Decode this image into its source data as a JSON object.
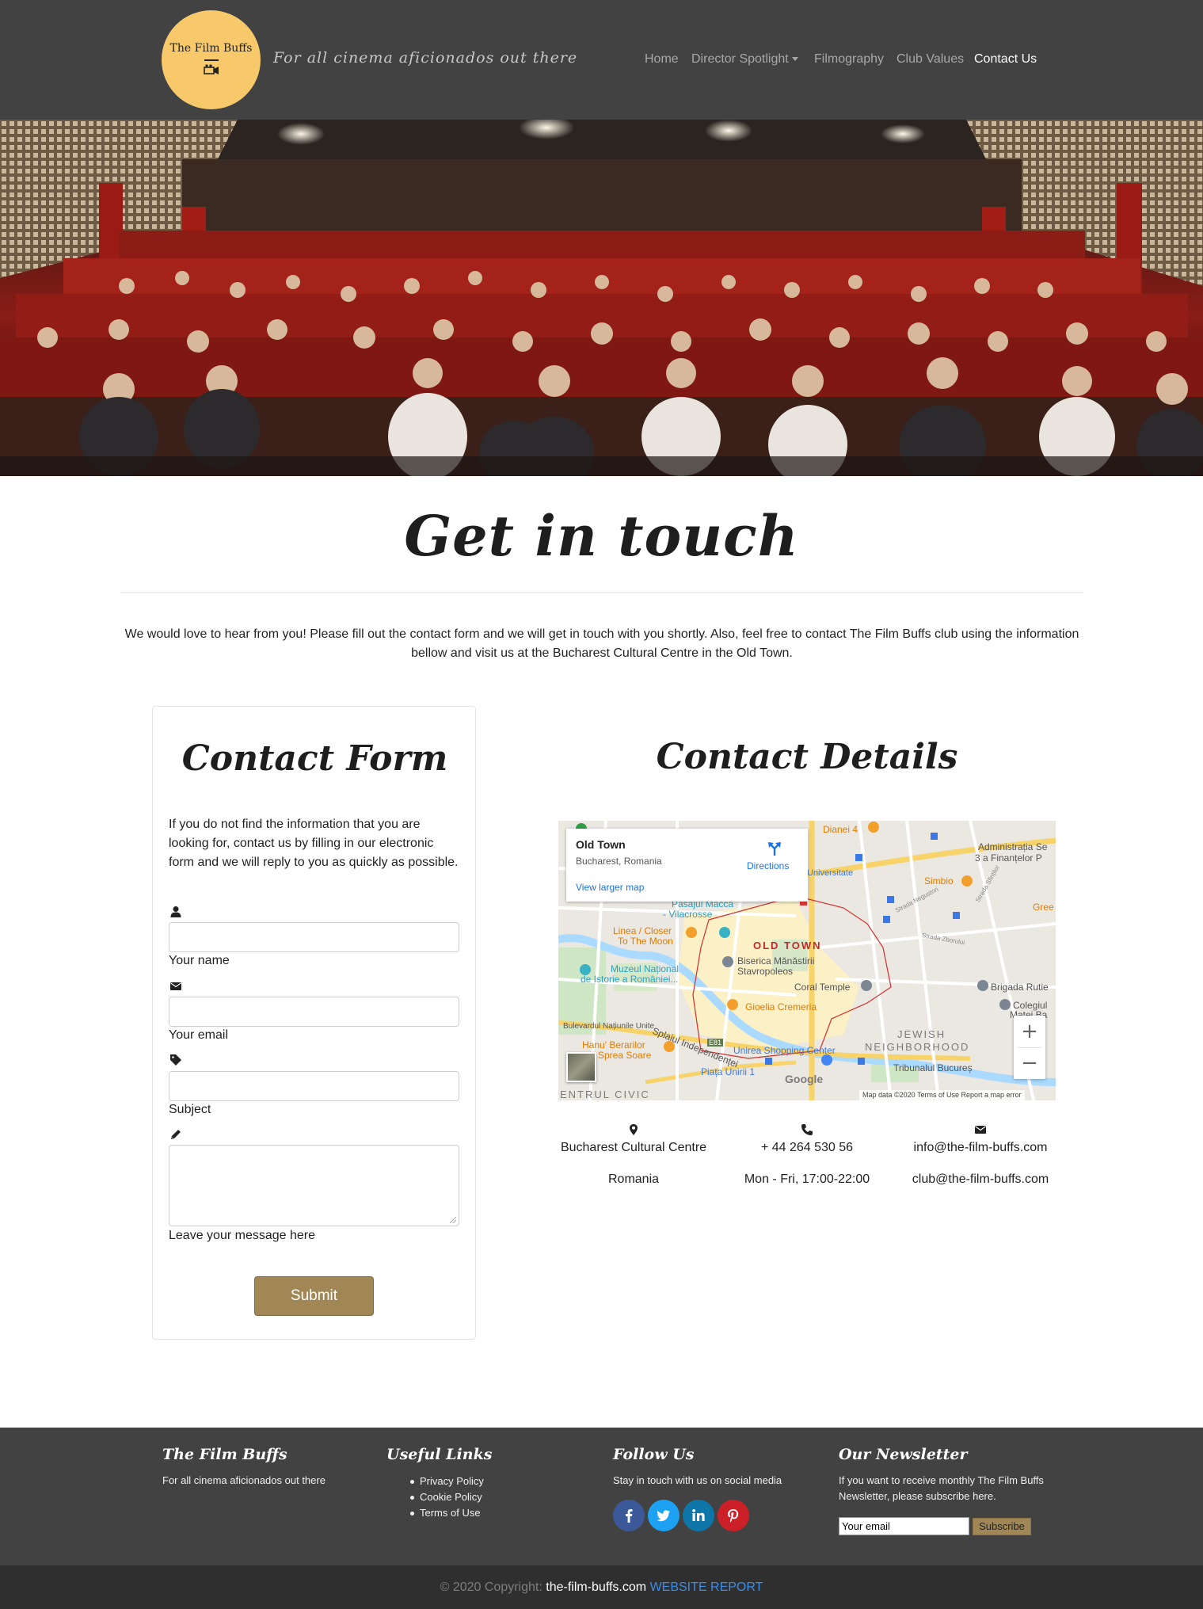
{
  "navbar": {
    "logo_text": "The Film Buffs",
    "tagline": "For all cinema aficionados out there",
    "links": [
      {
        "label": "Home"
      },
      {
        "label": "Director Spotlight"
      },
      {
        "label": "Filmography"
      },
      {
        "label": "Club Values"
      },
      {
        "label": "Contact Us"
      }
    ],
    "active": "Contact Us"
  },
  "hero": {
    "icon": "cinema-audience-photo"
  },
  "main": {
    "title": "Get in touch",
    "intro": "We would love to hear from you! Please fill out the contact form and we will get in touch with you shortly. Also, feel free to contact The Film Buffs club using the information bellow and visit us at the Bucharest Cultural Centre in the Old Town."
  },
  "form": {
    "title": "Contact Form",
    "text": "If you do not find the information that you are looking for, contact us by filling in our electronic form and we will reply to you as quickly as possible.",
    "fields": {
      "name_label": "Your name",
      "email_label": "Your email",
      "subject_label": "Subject",
      "message_label": "Leave your message here"
    },
    "submit_label": "Submit"
  },
  "details": {
    "title": "Contact Details",
    "map": {
      "place": "Old Town",
      "address": "Bucharest, Romania",
      "larger_map": "View larger map",
      "directions": "Directions",
      "attribution": "Map data ©2020   Terms of Use   Report a map error",
      "google": "Google",
      "labels": {
        "dianei": "Dianei 4",
        "administratia": "Administrația Se",
        "finantelor": "3 a Finanțelor P",
        "universitate": "Universitate",
        "simbio": "Simbio",
        "gree": "Gree",
        "pasajul": "Pasajul Macca",
        "vilacrosse": "- Vilacrosse",
        "linea": "Linea / Closer",
        "tothemoon": "To The Moon",
        "old_town": "OLD TOWN",
        "biserica": "Biserica Mănăstirii",
        "stavropoleos": "Stavropoleos",
        "muzeul": "Muzeul Național",
        "istorie": "de Istorie a României...",
        "coral": "Coral Temple",
        "brigada": "Brigada Rutie",
        "colegiul": "Colegiul",
        "matei": "Matei Ba",
        "gioelia": "Gioelia Cremeria",
        "splaiul": "Splaiul Independenței",
        "bulevardul": "Bulevardul Națiunile Unite",
        "e81": "E81",
        "hanu": "Hanu' Berarilor",
        "sprea": "Sprea Soare",
        "unirea": "Unirea Shopping Center",
        "jewish1": "JEWISH",
        "jewish2": "NEIGHBORHOOD",
        "tribunalul": "Tribunalul Bucureș",
        "piata": "Piața Unirii 1",
        "centrul": "ENTRUL CIVIC",
        "strada_negustori": "Strada Negustori",
        "strada_zborului": "Strada Zborului",
        "strada_sfintilor": "Strada Sfinților",
        "zoom_in": "+",
        "zoom_out": "−"
      }
    },
    "location": {
      "line1": "Bucharest Cultural Centre",
      "line2": "Romania",
      "icon": "map-marker-icon"
    },
    "phone": {
      "line1": "+ 44 264 530 56",
      "line2": "Mon - Fri, 17:00-22:00",
      "icon": "phone-icon"
    },
    "email": {
      "line1": "info@the-film-buffs.com",
      "line2": "club@the-film-buffs.com",
      "icon": "envelope-icon"
    }
  },
  "footer": {
    "about": {
      "title": "The Film Buffs",
      "text": "For all cinema aficionados out there"
    },
    "links": {
      "title": "Useful Links",
      "items": [
        "Privacy Policy",
        "Cookie Policy",
        "Terms of Use"
      ]
    },
    "follow": {
      "title": "Follow Us",
      "text": "Stay in touch with us on social media"
    },
    "newsletter": {
      "title": "Our Newsletter",
      "text": "If you want to receive monthly The Film Buffs Newsletter, please subscribe here.",
      "placeholder": "Your email",
      "button": "Subscribe"
    },
    "colors": {
      "facebook": "#3b5998",
      "twitter": "#1da1f2",
      "linkedin": "#0e76a8",
      "pinterest": "#cb2027"
    }
  },
  "copyright": {
    "prefix": "© 2020 Copyright:",
    "site": "the-film-buffs.com",
    "report": "WEBSITE REPORT"
  },
  "colors": {
    "accent": "#a08755",
    "nav_bg": "#424242",
    "logo_bg": "#f7c96b"
  }
}
